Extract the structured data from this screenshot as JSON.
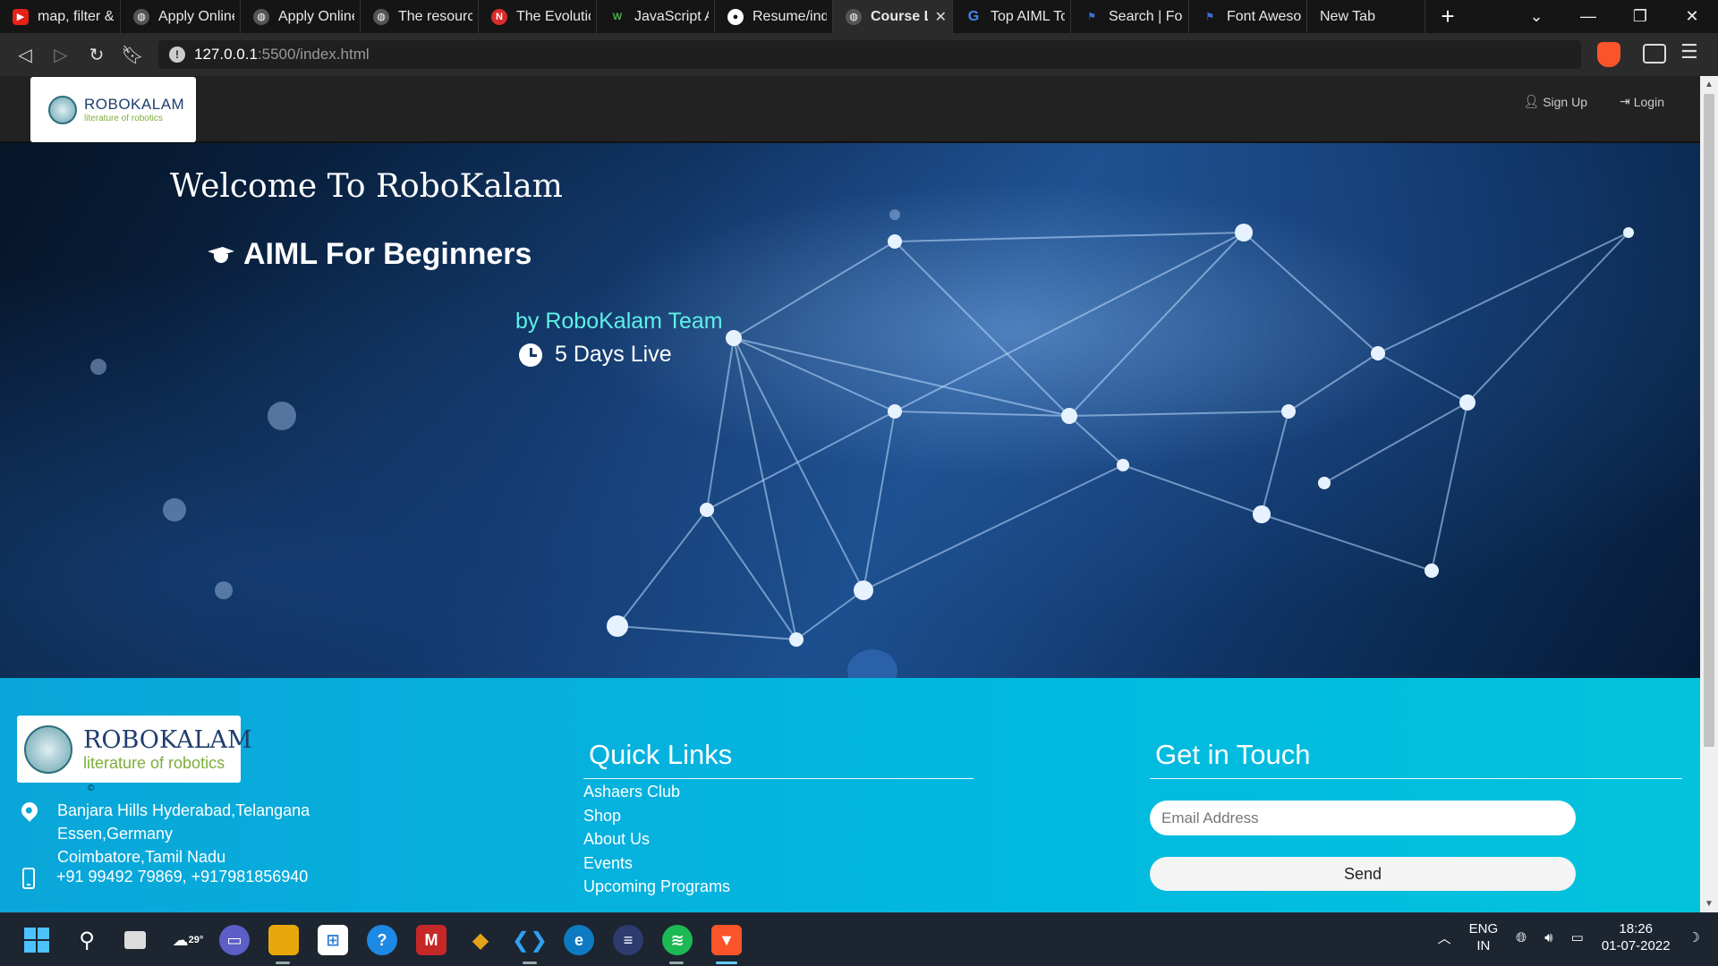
{
  "browser": {
    "tabs": [
      {
        "title": "map, filter &",
        "icon": "youtube-icon",
        "color": "#e62117"
      },
      {
        "title": "Apply Online",
        "icon": "globe-icon",
        "color": "#888888"
      },
      {
        "title": "Apply Online",
        "icon": "globe-icon",
        "color": "#888888"
      },
      {
        "title": "The resource",
        "icon": "globe-icon",
        "color": "#888888"
      },
      {
        "title": "The Evolution",
        "icon": "news-icon",
        "color": "#d92b2b"
      },
      {
        "title": "JavaScript Ar",
        "icon": "w-icon",
        "color": "#2e7d32"
      },
      {
        "title": "Resume/inde",
        "icon": "github-icon",
        "color": "#ffffff"
      },
      {
        "title": "Course La",
        "icon": "globe-icon",
        "color": "#888888",
        "active": true
      },
      {
        "title": "Top AIML To",
        "icon": "google-icon",
        "color": "#4285f4"
      },
      {
        "title": "Search | Font",
        "icon": "flag-icon",
        "color": "#3b6fd8"
      },
      {
        "title": "Font Aweson",
        "icon": "flag-icon",
        "color": "#3b6fd8"
      },
      {
        "title": "New Tab",
        "icon": "",
        "color": ""
      }
    ],
    "url_host": "127.0.0.1",
    "url_path": ":5500/index.html",
    "new_tab_label": "+",
    "minimize": "—",
    "maximize": "❐",
    "close": "✕"
  },
  "header": {
    "logo_name": "ROBOKALAM",
    "logo_tagline": "literature of robotics",
    "signup": "Sign Up",
    "login": "Login"
  },
  "hero": {
    "title": "Welcome To RoboKalam",
    "course": "AIML For Beginners",
    "by": "by RoboKalam Team",
    "duration": "5 Days Live"
  },
  "footer": {
    "logo_name": "ROBOKALAM",
    "logo_tagline": "literature of robotics",
    "copyright": "©",
    "address": [
      "Banjara Hills Hyderabad,Telangana",
      "Essen,Germany",
      "Coimbatore,Tamil Nadu"
    ],
    "phone": "+91 99492 79869, +917981856940",
    "quick_links_title": "Quick Links",
    "quick_links": [
      "Ashaers Club",
      "Shop",
      "About Us",
      "Events",
      "Upcoming Programs"
    ],
    "get_in_touch_title": "Get in Touch",
    "email_placeholder": "Email Address",
    "send_label": "Send"
  },
  "taskbar": {
    "weather": "29°",
    "lang_top": "ENG",
    "lang_bottom": "IN",
    "time": "18:26",
    "date": "01-07-2022"
  }
}
